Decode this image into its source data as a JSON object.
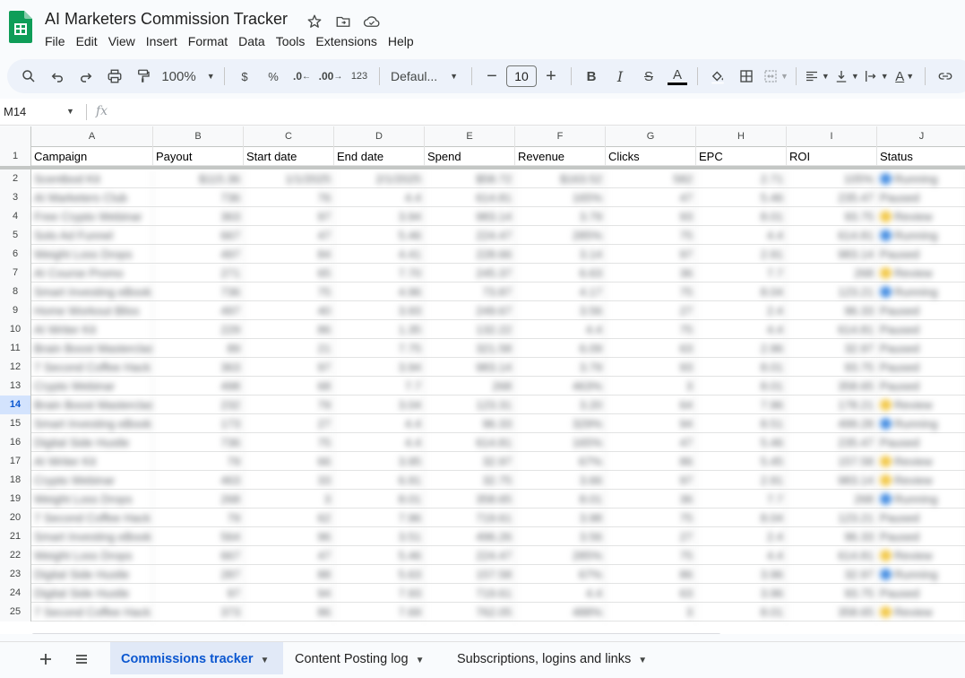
{
  "app": {
    "title": "AI Marketers Commission Tracker",
    "icons": [
      "star-icon",
      "move-to-folder-icon",
      "cloud-saved-icon"
    ],
    "brand_color": "#0f9d58"
  },
  "menu": [
    "File",
    "Edit",
    "View",
    "Insert",
    "Format",
    "Data",
    "Tools",
    "Extensions",
    "Help"
  ],
  "toolbar": {
    "zoom": "100%",
    "currency": "$",
    "percent": "%",
    "decrease_decimal": ".0",
    "increase_decimal": ".00",
    "number_format": "123",
    "font": "Defaul...",
    "font_size": "10"
  },
  "formula_bar": {
    "cell_ref": "M14",
    "fx": "fx",
    "value": ""
  },
  "columns": [
    "A",
    "B",
    "C",
    "D",
    "E",
    "F",
    "G",
    "H",
    "I",
    "J"
  ],
  "header": [
    "Campaign",
    "Payout",
    "Start date",
    "End date",
    "Spend",
    "Revenue",
    "Clicks",
    "EPC",
    "ROI",
    "Status"
  ],
  "selected_row": 14,
  "rows": [
    {
      "n": 2,
      "c": [
        "Scentbod Kit",
        "$115.36",
        "1/1/2025",
        "2/1/2025",
        "$58.72",
        "$163.52",
        "582",
        "2.71",
        "105%",
        "Running"
      ]
    },
    {
      "n": 3,
      "c": [
        "AI Marketers Club",
        "736",
        "76",
        "4.4",
        "614.81",
        "165%",
        "47",
        "5.46",
        "235.47",
        "Paused"
      ]
    },
    {
      "n": 4,
      "c": [
        "Free Crypto Webinar",
        "363",
        "97",
        "3.94",
        "983.14",
        "3.79",
        "93",
        "8.01",
        "93.75",
        "Review"
      ]
    },
    {
      "n": 5,
      "c": [
        "Solo Ad Funnel",
        "667",
        "47",
        "5.46",
        "224.47",
        "285%",
        "75",
        "4.4",
        "614.81",
        "Running"
      ]
    },
    {
      "n": 6,
      "c": [
        "Weight Loss Drops",
        "497",
        "84",
        "4.41",
        "228.66",
        "3.14",
        "97",
        "2.91",
        "983.14",
        "Paused"
      ]
    },
    {
      "n": 7,
      "c": [
        "AI Course Promo",
        "271",
        "65",
        "7.70",
        "245.37",
        "6.63",
        "36",
        "7.7",
        "268",
        "Review"
      ]
    },
    {
      "n": 8,
      "c": [
        "Smart Investing eBook",
        "736",
        "75",
        "4.96",
        "73.87",
        "4.17",
        "75",
        "8.04",
        "123.21",
        "Running"
      ]
    },
    {
      "n": 9,
      "c": [
        "Home Workout Bliss",
        "497",
        "40",
        "3.93",
        "249.67",
        "3.56",
        "27",
        "2.4",
        "96.33",
        "Paused"
      ]
    },
    {
      "n": 10,
      "c": [
        "AI Writer Kit",
        "229",
        "86",
        "1.35",
        "132.22",
        "4.4",
        "75",
        "4.4",
        "614.81",
        "Paused"
      ]
    },
    {
      "n": 11,
      "c": [
        "Brain Boost Masterclass",
        "89",
        "21",
        "7.75",
        "321.58",
        "6.09",
        "63",
        "2.96",
        "32.97",
        "Paused"
      ]
    },
    {
      "n": 12,
      "c": [
        "7 Second Coffee Hack",
        "363",
        "97",
        "3.94",
        "983.14",
        "3.79",
        "93",
        "8.01",
        "93.75",
        "Paused"
      ]
    },
    {
      "n": 13,
      "c": [
        "Crypto Webinar",
        "498",
        "68",
        "7.7",
        "268",
        "463%",
        "3",
        "8.01",
        "358.65",
        "Paused"
      ]
    },
    {
      "n": 14,
      "c": [
        "Brain Boost Masterclass",
        "232",
        "79",
        "3.04",
        "123.31",
        "3.20",
        "64",
        "7.96",
        "178.21",
        "Review"
      ]
    },
    {
      "n": 15,
      "c": [
        "Smart Investing eBook",
        "173",
        "27",
        "4.4",
        "96.33",
        "329%",
        "94",
        "8.51",
        "499.28",
        "Running"
      ]
    },
    {
      "n": 16,
      "c": [
        "Digital Side Hustle",
        "736",
        "75",
        "4.4",
        "614.81",
        "165%",
        "47",
        "5.46",
        "235.47",
        "Paused"
      ]
    },
    {
      "n": 17,
      "c": [
        "AI Writer Kit",
        "79",
        "66",
        "3.95",
        "32.97",
        "67%",
        "86",
        "5.45",
        "157.58",
        "Review"
      ]
    },
    {
      "n": 18,
      "c": [
        "Crypto Webinar",
        "463",
        "33",
        "6.91",
        "32.75",
        "3.66",
        "97",
        "2.91",
        "983.14",
        "Review"
      ]
    },
    {
      "n": 19,
      "c": [
        "Weight Loss Drops",
        "268",
        "3",
        "8.01",
        "358.65",
        "8.01",
        "36",
        "7.7",
        "268",
        "Running"
      ]
    },
    {
      "n": 20,
      "c": [
        "7 Second Coffee Hack",
        "79",
        "62",
        "7.96",
        "719.61",
        "3.98",
        "75",
        "8.04",
        "123.21",
        "Paused"
      ]
    },
    {
      "n": 21,
      "c": [
        "Smart Investing eBook",
        "564",
        "96",
        "3.51",
        "496.26",
        "3.56",
        "27",
        "2.4",
        "96.33",
        "Paused"
      ]
    },
    {
      "n": 22,
      "c": [
        "Weight Loss Drops",
        "667",
        "47",
        "5.46",
        "224.47",
        "285%",
        "75",
        "4.4",
        "614.81",
        "Review"
      ]
    },
    {
      "n": 23,
      "c": [
        "Digital Side Hustle",
        "287",
        "88",
        "5.63",
        "157.58",
        "67%",
        "86",
        "3.96",
        "32.97",
        "Running"
      ]
    },
    {
      "n": 24,
      "c": [
        "Digital Side Hustle",
        "97",
        "94",
        "7.93",
        "719.61",
        "4.4",
        "63",
        "3.96",
        "93.75",
        "Paused"
      ]
    },
    {
      "n": 25,
      "c": [
        "7 Second Coffee Hack",
        "373",
        "86",
        "7.69",
        "762.05",
        "488%",
        "3",
        "8.01",
        "358.65",
        "Review"
      ]
    }
  ],
  "status_colors": {
    "Running": "#4a90e2",
    "Review": "#f2c94c"
  },
  "sheets": [
    {
      "label": "Commissions tracker",
      "active": true
    },
    {
      "label": "Content Posting log",
      "active": false
    },
    {
      "label": "Subscriptions, logins and links",
      "active": false
    }
  ]
}
